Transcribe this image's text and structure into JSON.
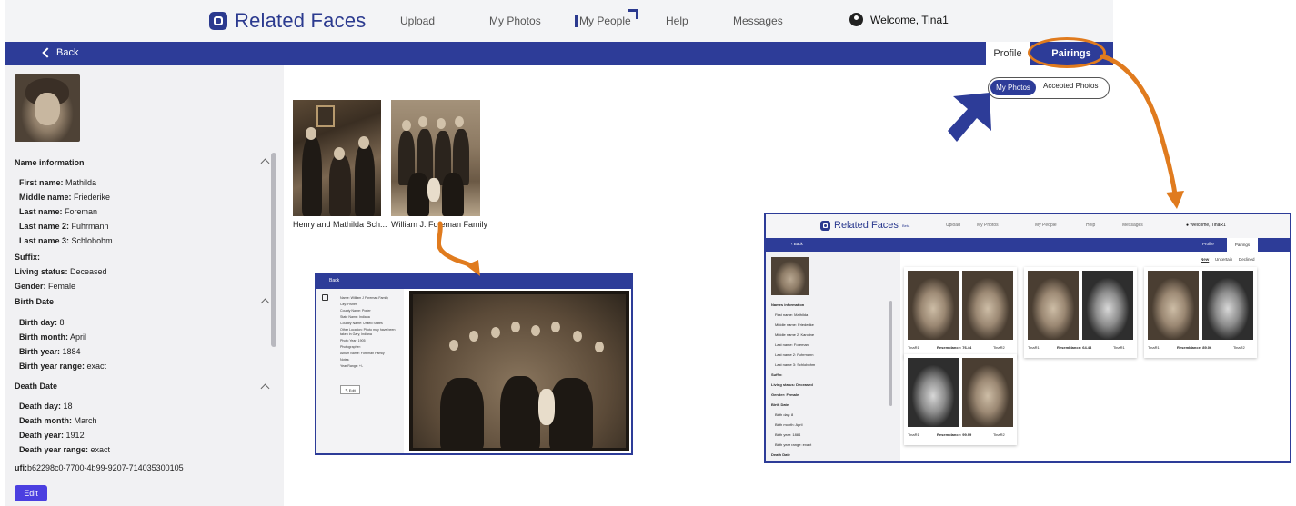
{
  "nav": {
    "brand": "Related Faces",
    "items": [
      "Upload",
      "My Photos",
      "My People",
      "Help",
      "Messages"
    ],
    "welcome": "Welcome, Tina1"
  },
  "bar": {
    "back": "Back",
    "tabs": [
      "Profile",
      "Pairings"
    ]
  },
  "sidebar": {
    "name_title": "Name information",
    "names": [
      {
        "label": "First name:",
        "value": "Mathilda"
      },
      {
        "label": "Middle name:",
        "value": "Friederike"
      },
      {
        "label": "Last name:",
        "value": "Foreman"
      },
      {
        "label": "Last name 2:",
        "value": "Fuhrmann"
      },
      {
        "label": "Last name 3:",
        "value": "Schlobohm"
      }
    ],
    "misc": [
      {
        "label": "Suffix:",
        "value": ""
      },
      {
        "label": "Living status:",
        "value": "Deceased"
      },
      {
        "label": "Gender:",
        "value": "Female"
      }
    ],
    "birth_title": "Birth Date",
    "birth": [
      {
        "label": "Birth day:",
        "value": "8"
      },
      {
        "label": "Birth month:",
        "value": "April"
      },
      {
        "label": "Birth year:",
        "value": "1884"
      },
      {
        "label": "Birth year range:",
        "value": "exact"
      }
    ],
    "death_title": "Death Date",
    "death": [
      {
        "label": "Death day:",
        "value": "18"
      },
      {
        "label": "Death month:",
        "value": "March"
      },
      {
        "label": "Death year:",
        "value": "1912"
      },
      {
        "label": "Death year range:",
        "value": "exact"
      }
    ],
    "ufi": {
      "label": "ufi:",
      "value": "b62298c0-7700-4b99-9207-714035300105"
    },
    "edit": "Edit"
  },
  "photos": [
    {
      "caption": "Henry and Mathilda Sch..."
    },
    {
      "caption": "William J. Foreman Family"
    }
  ],
  "toggle": {
    "active": "My Photos",
    "inactive": "Accepted Photos"
  },
  "inset": {
    "back": "Back",
    "lines": [
      "Name: William J Foreman Family",
      "City: Fisher",
      "County Name: Porter",
      "State Name: Indiana",
      "Country Name: United States",
      "Other Location: Photo may have been",
      "taken in Gary, Indiana",
      "Photo Year: 1905",
      "Photographer:",
      "Album Name: Foreman Family",
      "Notes:",
      "Year Range: +/-"
    ],
    "edit": "Edit"
  },
  "shot": {
    "brand": "Related Faces",
    "brand_sup": "Beta",
    "nav": [
      "Upload",
      "My Photos",
      "My People",
      "Help",
      "Messages"
    ],
    "welcome": "Welcome, TinaR1",
    "back": "Back",
    "tabs": [
      "Profile",
      "Pairings"
    ],
    "filters": [
      "New",
      "Uncertain",
      "Declined"
    ],
    "side_lines": [
      {
        "text": "Names information",
        "bold": true
      },
      {
        "text": "First name: Mathilda",
        "bold": false
      },
      {
        "text": "Middle name: Friederike",
        "bold": false
      },
      {
        "text": "Middle name 2: Karoline",
        "bold": false
      },
      {
        "text": "Last name: Foreman",
        "bold": false
      },
      {
        "text": "Last name 2: Fuhrmann",
        "bold": false
      },
      {
        "text": "Last name 3: Schlobohm",
        "bold": false
      },
      {
        "text": "Suffix:",
        "bold": true
      },
      {
        "text": "Living status: Deceased",
        "bold": true
      },
      {
        "text": "Gender: Female",
        "bold": true
      },
      {
        "text": "Birth Date",
        "bold": true
      },
      {
        "text": "Birth day: 8",
        "bold": false
      },
      {
        "text": "Birth month: April",
        "bold": false
      },
      {
        "text": "Birth year: 1884",
        "bold": false
      },
      {
        "text": "Birth year range: exact",
        "bold": false
      },
      {
        "text": "Death Date",
        "bold": true
      }
    ],
    "cards": [
      {
        "left": "TinaR1",
        "score": "Resemblance: 76.44",
        "right": "TinaR2"
      },
      {
        "left": "TinaR1",
        "score": "Resemblance: 64.48",
        "right": "TinaR1"
      },
      {
        "left": "TinaR1",
        "score": "Resemblance: 89.06",
        "right": "TinaR2"
      },
      {
        "left": "TinaR1",
        "score": "Resemblance: 99.99",
        "right": "TinaR2"
      }
    ]
  },
  "colors": {
    "primary": "#2d3c98",
    "accent": "#e07b1e",
    "edit": "#4b3fe0"
  }
}
